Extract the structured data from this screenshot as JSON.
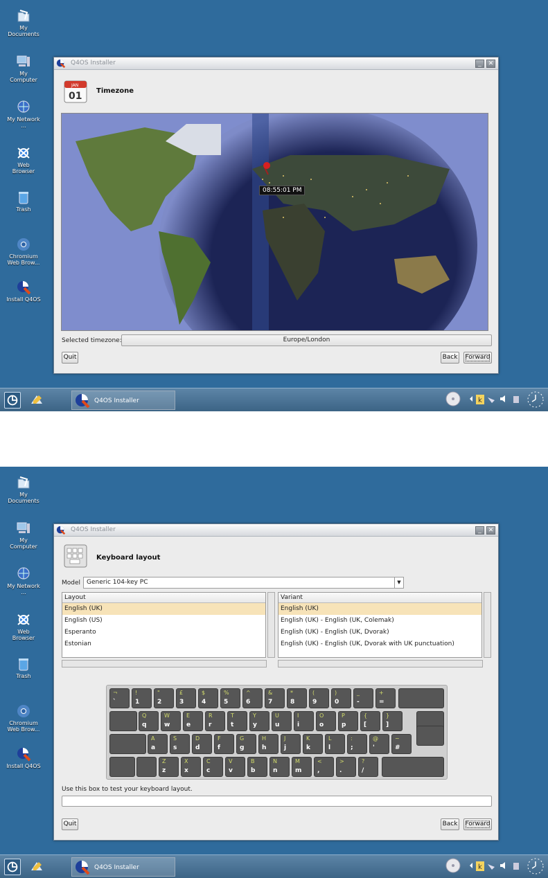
{
  "desktop_icons": [
    {
      "label": "My Documents",
      "icon": "folder-documents-icon"
    },
    {
      "label": "My Computer",
      "icon": "computer-icon"
    },
    {
      "label": "My Network ...",
      "icon": "network-globe-icon"
    },
    {
      "label": "Web Browser",
      "icon": "web-browser-icon"
    },
    {
      "label": "Trash",
      "icon": "trash-icon"
    },
    {
      "label": "Chromium Web Brow...",
      "icon": "chromium-icon"
    },
    {
      "label": "Install Q4OS",
      "icon": "q4os-installer-icon"
    }
  ],
  "window": {
    "title": "Q4OS Installer",
    "minimize": "_",
    "close": "✕"
  },
  "timezone": {
    "title": "Timezone",
    "calendar_month": "JAN",
    "calendar_day": "01",
    "map_time": "08:55:01 PM",
    "selected_label": "Selected timezone:",
    "selected_value": "Europe/London"
  },
  "keyboard": {
    "title": "Keyboard layout",
    "model_label": "Model",
    "model_value": "Generic 104-key PC",
    "layout_header": "Layout",
    "variant_header": "Variant",
    "layouts": [
      "English (UK)",
      "English (US)",
      "Esperanto",
      "Estonian"
    ],
    "variants": [
      "English (UK)",
      "English (UK) - English (UK, Colemak)",
      "English (UK) - English (UK, Dvorak)",
      "English (UK) - English (UK, Dvorak with UK punctuation)"
    ],
    "test_label": "Use this box to test your keyboard layout.",
    "row1": [
      [
        "¬",
        "`"
      ],
      [
        "!",
        "1"
      ],
      [
        "\"",
        "2"
      ],
      [
        "£",
        "3"
      ],
      [
        "$",
        "4"
      ],
      [
        "%",
        "5"
      ],
      [
        "^",
        "6"
      ],
      [
        "&",
        "7"
      ],
      [
        "*",
        "8"
      ],
      [
        "(",
        "9"
      ],
      [
        ")",
        "0"
      ],
      [
        "_",
        "-"
      ],
      [
        "+",
        "="
      ]
    ],
    "row2": [
      [
        "Q",
        "q"
      ],
      [
        "W",
        "w"
      ],
      [
        "E",
        "e"
      ],
      [
        "R",
        "r"
      ],
      [
        "T",
        "t"
      ],
      [
        "Y",
        "y"
      ],
      [
        "U",
        "u"
      ],
      [
        "I",
        "i"
      ],
      [
        "O",
        "o"
      ],
      [
        "P",
        "p"
      ],
      [
        "{",
        "["
      ],
      [
        "}",
        "]"
      ]
    ],
    "row3": [
      [
        "A",
        "a"
      ],
      [
        "S",
        "s"
      ],
      [
        "D",
        "d"
      ],
      [
        "F",
        "f"
      ],
      [
        "G",
        "g"
      ],
      [
        "H",
        "h"
      ],
      [
        "J",
        "j"
      ],
      [
        "K",
        "k"
      ],
      [
        "L",
        "l"
      ],
      [
        ":",
        ";"
      ],
      [
        "@",
        "'"
      ],
      [
        "~",
        "#"
      ]
    ],
    "row4": [
      [
        "Z",
        "z"
      ],
      [
        "X",
        "x"
      ],
      [
        "C",
        "c"
      ],
      [
        "V",
        "v"
      ],
      [
        "B",
        "b"
      ],
      [
        "N",
        "n"
      ],
      [
        "M",
        "m"
      ],
      [
        "<",
        ","
      ],
      [
        ">",
        "."
      ],
      [
        "?",
        "/"
      ]
    ]
  },
  "buttons": {
    "quit": "Quit",
    "back": "Back",
    "forward": "Forward"
  },
  "taskbar": {
    "app_label": "Q4OS Installer"
  }
}
